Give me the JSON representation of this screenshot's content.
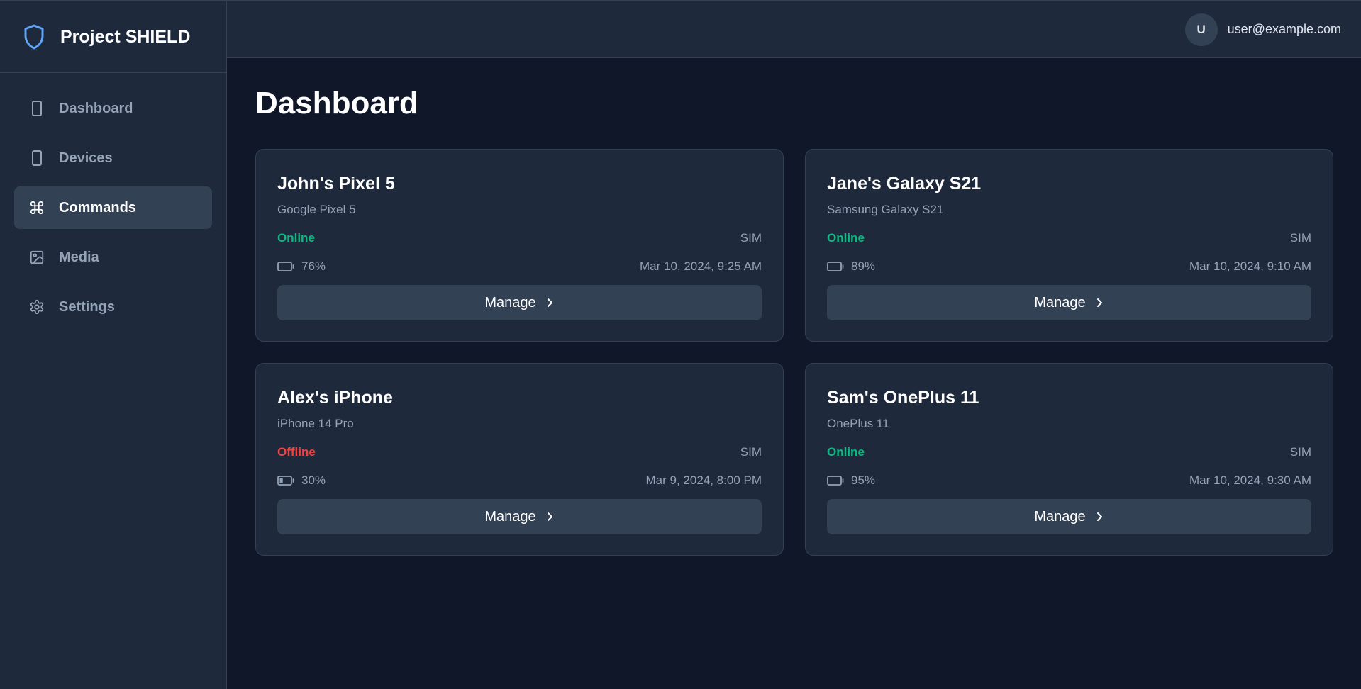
{
  "brand": {
    "name": "Project SHIELD",
    "accent": "#60a5fa"
  },
  "sidebar": {
    "items": [
      {
        "label": "Dashboard",
        "icon": "smartphone-icon",
        "active": false
      },
      {
        "label": "Devices",
        "icon": "smartphone-icon",
        "active": false
      },
      {
        "label": "Commands",
        "icon": "command-icon",
        "active": true
      },
      {
        "label": "Media",
        "icon": "image-icon",
        "active": false
      },
      {
        "label": "Settings",
        "icon": "gear-icon",
        "active": false
      }
    ]
  },
  "header": {
    "avatar_initial": "U",
    "user_email": "user@example.com"
  },
  "main": {
    "title": "Dashboard"
  },
  "colors": {
    "online": "#10b981",
    "offline": "#ef4444"
  },
  "devices": [
    {
      "name": "John's Pixel 5",
      "model": "Google Pixel 5",
      "status": "Online",
      "connection": "SIM",
      "battery": "76%",
      "battery_level": 0.76,
      "last_seen": "Mar 10, 2024, 9:25 AM",
      "action": "Manage"
    },
    {
      "name": "Jane's Galaxy S21",
      "model": "Samsung Galaxy S21",
      "status": "Online",
      "connection": "SIM",
      "battery": "89%",
      "battery_level": 0.89,
      "last_seen": "Mar 10, 2024, 9:10 AM",
      "action": "Manage"
    },
    {
      "name": "Alex's iPhone",
      "model": "iPhone 14 Pro",
      "status": "Offline",
      "connection": "SIM",
      "battery": "30%",
      "battery_level": 0.3,
      "last_seen": "Mar 9, 2024, 8:00 PM",
      "action": "Manage"
    },
    {
      "name": "Sam's OnePlus 11",
      "model": "OnePlus 11",
      "status": "Online",
      "connection": "SIM",
      "battery": "95%",
      "battery_level": 0.95,
      "last_seen": "Mar 10, 2024, 9:30 AM",
      "action": "Manage"
    }
  ]
}
